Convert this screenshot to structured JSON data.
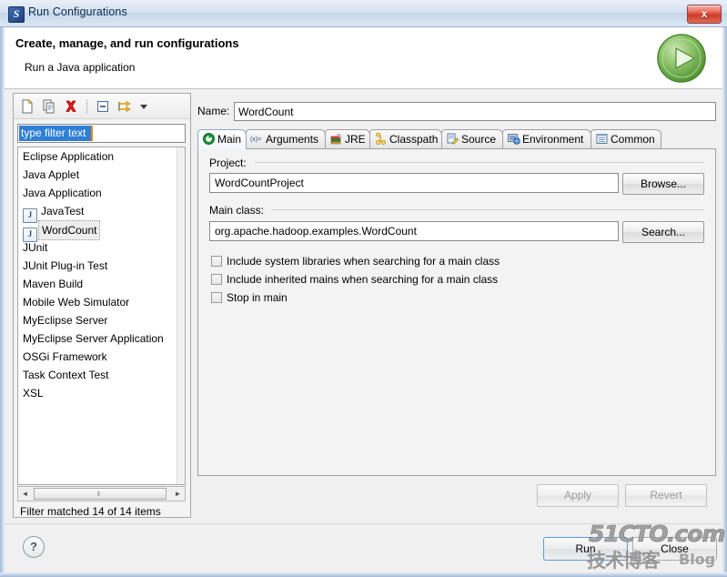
{
  "window": {
    "title": "Run Configurations",
    "icon": "eclipse-launch-icon",
    "close_label": "x"
  },
  "header": {
    "title": "Create, manage, and run configurations",
    "subtitle": "Run a Java application",
    "run_icon": "green-run-play-icon"
  },
  "left_panel": {
    "toolbar": [
      {
        "name": "new-launch-configuration-icon",
        "tooltip": "New launch configuration"
      },
      {
        "name": "duplicate-launch-configuration-icon",
        "tooltip": "Duplicate"
      },
      {
        "name": "delete-launch-configuration-icon",
        "tooltip": "Delete"
      },
      {
        "name": "collapse-all-icon",
        "tooltip": "Collapse All"
      },
      {
        "name": "filter-launch-configurations-icon",
        "tooltip": "Filter"
      },
      {
        "name": "view-menu-chevron-down-icon",
        "tooltip": "View Menu"
      }
    ],
    "filter": {
      "value": "type filter text",
      "placeholder": "type filter text"
    },
    "tree": [
      {
        "label": "Eclipse Application",
        "icon": "",
        "child": false,
        "selected": false
      },
      {
        "label": "Java Applet",
        "icon": "",
        "child": false,
        "selected": false
      },
      {
        "label": "Java Application",
        "icon": "",
        "child": false,
        "selected": false
      },
      {
        "label": "JavaTest",
        "icon": "java-class-icon",
        "child": true,
        "selected": false
      },
      {
        "label": "WordCount",
        "icon": "java-class-icon",
        "child": true,
        "selected": true
      },
      {
        "label": "JUnit",
        "icon": "",
        "child": false,
        "selected": false
      },
      {
        "label": "JUnit Plug-in Test",
        "icon": "",
        "child": false,
        "selected": false
      },
      {
        "label": "Maven Build",
        "icon": "",
        "child": false,
        "selected": false
      },
      {
        "label": "Mobile Web Simulator",
        "icon": "",
        "child": false,
        "selected": false
      },
      {
        "label": "MyEclipse Server",
        "icon": "",
        "child": false,
        "selected": false
      },
      {
        "label": "MyEclipse Server Application",
        "icon": "",
        "child": false,
        "selected": false
      },
      {
        "label": "OSGi Framework",
        "icon": "",
        "child": false,
        "selected": false
      },
      {
        "label": "Task Context Test",
        "icon": "",
        "child": false,
        "selected": false
      },
      {
        "label": "XSL",
        "icon": "",
        "child": false,
        "selected": false
      }
    ],
    "scroll_left_arrow": "◄",
    "scroll_right_arrow": "►",
    "scroll_grip": "‖",
    "filter_status": "Filter matched 14 of 14 items"
  },
  "right_panel": {
    "name_label": "Name:",
    "name_value": "WordCount",
    "tabs": [
      {
        "label": "Main",
        "icon": "main-tab-icon",
        "active": true
      },
      {
        "label": "Arguments",
        "icon": "arguments-tab-icon",
        "active": false
      },
      {
        "label": "JRE",
        "icon": "jre-tab-icon",
        "active": false
      },
      {
        "label": "Classpath",
        "icon": "classpath-tab-icon",
        "active": false
      },
      {
        "label": "Source",
        "icon": "source-tab-icon",
        "active": false
      },
      {
        "label": "Environment",
        "icon": "environment-tab-icon",
        "active": false
      },
      {
        "label": "Common",
        "icon": "common-tab-icon",
        "active": false
      }
    ],
    "main_tab": {
      "project_label": "Project:",
      "project_value": "WordCountProject",
      "browse_label": "Browse...",
      "main_class_label": "Main class:",
      "main_class_value": "org.apache.hadoop.examples.WordCount",
      "search_label": "Search...",
      "checkboxes": [
        {
          "label": "Include system libraries when searching for a main class",
          "checked": false
        },
        {
          "label": "Include inherited mains when searching for a main class",
          "checked": false
        },
        {
          "label": "Stop in main",
          "checked": false
        }
      ]
    },
    "apply_label": "Apply",
    "revert_label": "Revert"
  },
  "footer": {
    "help_label": "?",
    "run_label": "Run",
    "close_label": "Close"
  },
  "watermark": {
    "top": "51CTO.com",
    "cn": "技术博客",
    "blog": "Blog"
  },
  "colors": {
    "title_bar": "#d6e3f0",
    "accent_blue": "#2f7fd8",
    "close_red": "#cf3b29",
    "run_green": "#5aab3c",
    "focus_border": "#5b9bd5"
  }
}
